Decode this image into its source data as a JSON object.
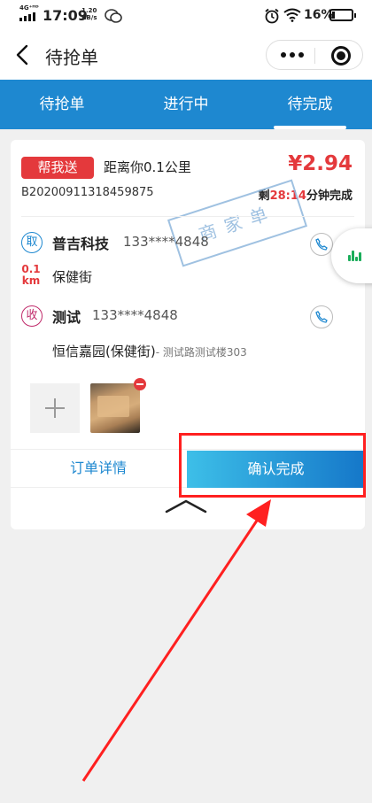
{
  "status": {
    "network": "4G⁺ᴴᴰ",
    "time": "17:09",
    "speed_value": "1.20",
    "speed_unit": "KB/s",
    "battery": "16%"
  },
  "nav": {
    "title": "待抢单"
  },
  "tabs": [
    {
      "label": "待抢单",
      "active": false
    },
    {
      "label": "进行中",
      "active": false
    },
    {
      "label": "待完成",
      "active": true
    }
  ],
  "order": {
    "service_type": "帮我送",
    "distance_text": "距离你0.1公里",
    "price": "¥2.94",
    "order_id": "B20200911318459875",
    "time_prefix": "剩",
    "countdown": "28:14",
    "time_suffix": "分钟完成",
    "merchant_stamp": "商家单",
    "pickup": {
      "icon_text": "取",
      "name": "普吉科技",
      "phone": "133****4848",
      "distance_value": "0.1",
      "distance_unit": "km",
      "address": "保健街"
    },
    "delivery": {
      "icon_text": "收",
      "name": "测试",
      "phone": "133****4848",
      "address_main": "恒信嘉园(保健街)",
      "address_detail": "- 测试路测试楼303"
    },
    "detail_label": "订单详情",
    "confirm_label": "确认完成"
  },
  "colors": {
    "brand_blue": "#1e88d0",
    "accent_red": "#e4393c",
    "annotation_red": "#ff2020"
  }
}
